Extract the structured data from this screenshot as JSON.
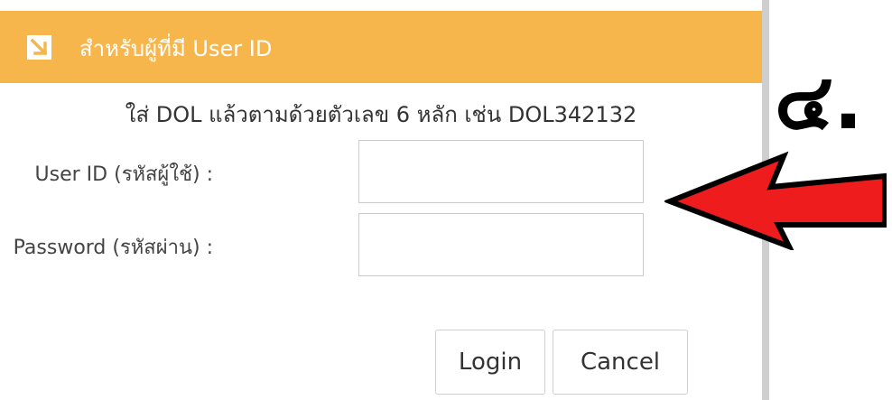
{
  "header": {
    "icon": "arrow-down-right-icon",
    "title": "สำหรับผู้ที่มี User ID"
  },
  "instruction": "ใส่ DOL แล้วตามด้วยตัวเลข 6 หลัก เช่น DOL342132",
  "form": {
    "user_id_label": "User ID (รหัสผู้ใช้) :",
    "user_id_value": "",
    "password_label": "Password (รหัสผ่าน) :",
    "password_value": ""
  },
  "buttons": {
    "login_label": "Login",
    "cancel_label": "Cancel"
  },
  "annotation": {
    "step_number": "๔.",
    "arrow_color": "#ee1c1c",
    "arrow_icon": "red-arrow-left-icon"
  },
  "colors": {
    "header_bg": "#f7b64b",
    "header_text": "#ffffff"
  }
}
